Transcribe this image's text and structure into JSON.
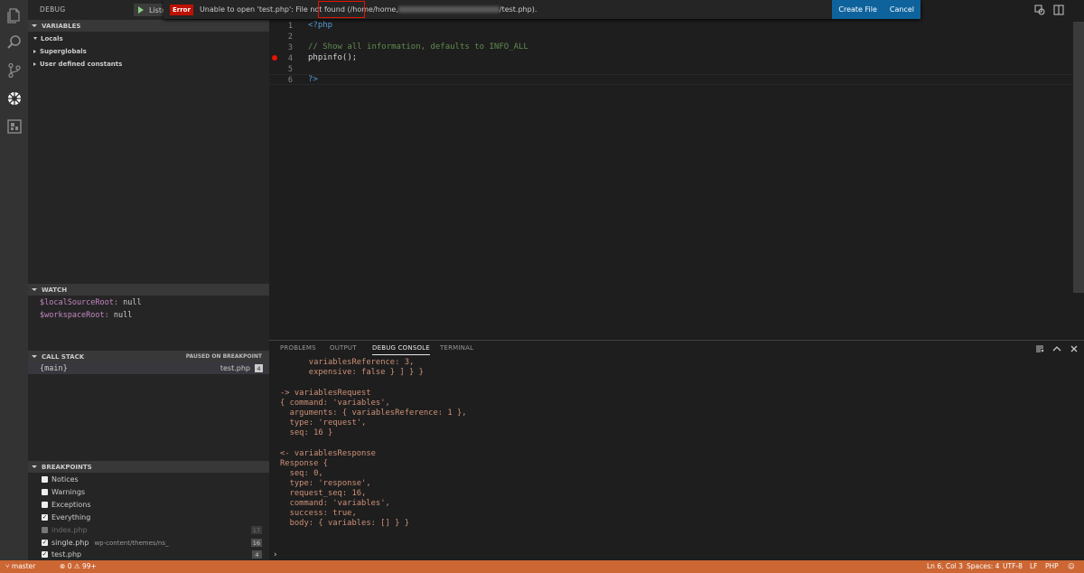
{
  "sidebar": {
    "title": "DEBUG",
    "run_label": "Liste",
    "variables": {
      "header": "VARIABLES",
      "scopes": [
        "Locals",
        "Superglobals",
        "User defined constants"
      ]
    },
    "watch": {
      "header": "WATCH",
      "items": [
        {
          "name": "$localSourceRoot:",
          "value": "null"
        },
        {
          "name": "$workspaceRoot:",
          "value": "null"
        }
      ]
    },
    "call_stack": {
      "header": "CALL STACK",
      "status": "PAUSED ON BREAKPOINT",
      "frame": {
        "name": "{main}",
        "file": "test.php",
        "line": "4"
      }
    },
    "breakpoints": {
      "header": "BREAKPOINTS",
      "items": [
        {
          "label": "Notices",
          "checked": false
        },
        {
          "label": "Warnings",
          "checked": false
        },
        {
          "label": "Exceptions",
          "checked": false
        },
        {
          "label": "Everything",
          "checked": true
        },
        {
          "label": "index.php",
          "checked": false,
          "count": "17"
        },
        {
          "label": "single.php",
          "checked": true,
          "path": "wp-content/themes/ns_",
          "count": "16"
        },
        {
          "label": "test.php",
          "checked": true,
          "count": "4"
        }
      ]
    }
  },
  "notification": {
    "badge": "Error",
    "message_start": "Unable to open 'test.php': File not found (",
    "message_highlight": "/home/home,",
    "message_end": "/test.php).",
    "primary_action": "Create File",
    "secondary_action": "Cancel"
  },
  "editor": {
    "line_numbers": [
      "1",
      "2",
      "3",
      "4",
      "5",
      "6"
    ],
    "lines": [
      {
        "text": "<?php",
        "color": "#569cd6"
      },
      {
        "text": "",
        "color": "#d4d4d4"
      },
      {
        "text": "// Show all information, defaults to INFO_ALL",
        "color": "#608b4e"
      },
      {
        "text": "phpinfo();",
        "color": "#d4d4d4"
      },
      {
        "text": "",
        "color": "#d4d4d4"
      },
      {
        "text": "?>",
        "color": "#569cd6"
      }
    ]
  },
  "panel": {
    "tabs": [
      "PROBLEMS",
      "OUTPUT",
      "DEBUG CONSOLE",
      "TERMINAL"
    ],
    "active_tab": "DEBUG CONSOLE",
    "console_lines": [
      "      variablesReference: 3,",
      "      expensive: false } ] } }",
      "",
      "-> variablesRequest",
      "{ command: 'variables',",
      "  arguments: { variablesReference: 1 },",
      "  type: 'request',",
      "  seq: 16 }",
      "",
      "<- variablesResponse",
      "Response {",
      "  seq: 0,",
      "  type: 'response',",
      "  request_seq: 16,",
      "  command: 'variables',",
      "  success: true,",
      "  body: { variables: [] } }"
    ],
    "prompt": "›"
  },
  "status_bar": {
    "branch": "master",
    "errors": "0",
    "warnings": "99+",
    "position": "Ln 6, Col 3",
    "spaces": "Spaces: 4",
    "encoding": "UTF-8",
    "eol": "LF",
    "language": "PHP"
  },
  "colors": {
    "status_bar": "#cc6633",
    "error_badge": "#be1100",
    "action_button": "#0e639c",
    "breakpoint": "#e51400"
  }
}
